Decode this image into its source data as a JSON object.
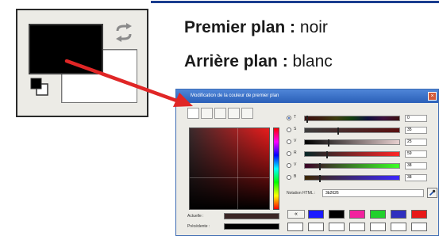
{
  "labels": {
    "foreground": {
      "term": "Premier plan :",
      "value": " noir"
    },
    "background": {
      "term": "Arrière plan :",
      "value": " blanc"
    }
  },
  "colors": {
    "foreground": "#000000",
    "background": "#ffffff",
    "accent_arrow": "#e02626",
    "dialog_title_bar": "#2a5fb8"
  },
  "dialog": {
    "title": "Modification de la couleur de premier plan",
    "close_label": "×",
    "tools": [
      "gimp-selector-icon",
      "cmyk-selector-icon",
      "watercolor-icon",
      "wheel-icon",
      "palette-icon"
    ],
    "channels": [
      {
        "letter": "T",
        "value": "0",
        "selected": true,
        "marker": 0.02,
        "gradient": [
          "#3d1010",
          "#3d2010",
          "#3d3d10",
          "#103d10",
          "#10103d",
          "#3d103d",
          "#3d1010"
        ]
      },
      {
        "letter": "S",
        "value": "35",
        "selected": false,
        "marker": 0.35,
        "gradient": [
          "#3d3d3d",
          "#5a1010"
        ]
      },
      {
        "letter": "V",
        "value": "25",
        "selected": false,
        "marker": 0.25,
        "gradient": [
          "#000000",
          "#e8d0d0"
        ]
      },
      {
        "letter": "R",
        "value": "59",
        "selected": false,
        "marker": 0.23,
        "gradient": [
          "#052626",
          "#ff2626"
        ]
      },
      {
        "letter": "V",
        "value": "38",
        "selected": false,
        "marker": 0.15,
        "gradient": [
          "#3b0026",
          "#3bff26"
        ]
      },
      {
        "letter": "B",
        "value": "38",
        "selected": false,
        "marker": 0.15,
        "gradient": [
          "#3b2600",
          "#3b26ff"
        ]
      }
    ],
    "hex_label": "Notation HTML :",
    "hex_value": "3b2626",
    "current_label": "Actuelle :",
    "previous_label": "Précédente :",
    "current_color": "#3b2626",
    "previous_color": "#000000",
    "history_button_label": "«",
    "history_row1": [
      "#1a1aff",
      "#000000",
      "#f2219e",
      "#21d12c",
      "#2f2fbf",
      "#e81818"
    ],
    "history_row2": [
      "#ffffff",
      "#ffffff",
      "#ffffff",
      "#ffffff",
      "#ffffff",
      "#ffffff",
      "#ffffff"
    ]
  }
}
